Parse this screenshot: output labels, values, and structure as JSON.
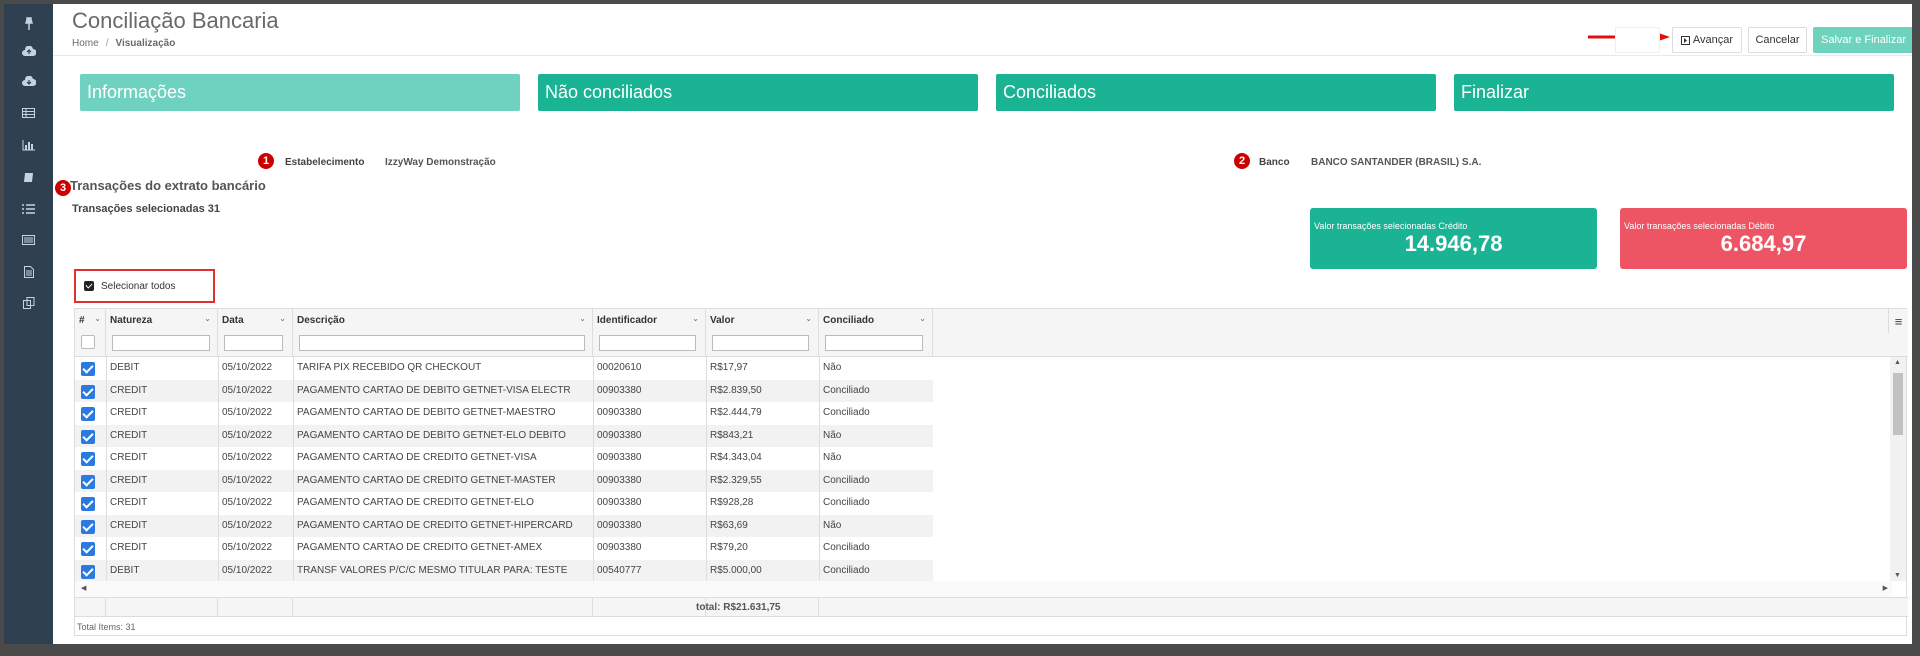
{
  "header": {
    "title": "Conciliação Bancaria",
    "breadcrumb": [
      {
        "label": "Home"
      },
      {
        "label": "Visualização"
      }
    ],
    "buttons": {
      "avancar": "Avançar",
      "cancelar": "Cancelar",
      "salvar": "Salvar e Finalizar"
    }
  },
  "steps": [
    "Informações",
    "Não conciliados",
    "Conciliados",
    "Finalizar"
  ],
  "info": {
    "estabelecimento_label": "Estabelecimento",
    "estabelecimento_value": "IzzyWay Demonstração",
    "banco_label": "Banco",
    "banco_value": "BANCO SANTANDER (BRASIL) S.A."
  },
  "badges": [
    "1",
    "2",
    "3"
  ],
  "section": {
    "title": "Transações do extrato bancário",
    "selected_text": "Transações selecionadas 31"
  },
  "kpis": {
    "credit_label": "Valor transações selecionadas Crédito",
    "credit_value": "14.946,78",
    "debit_label": "Valor transações selecionadas Débito",
    "debit_value": "6.684,97"
  },
  "select_all_label": "Selecionar todos",
  "grid": {
    "columns": [
      "#",
      "Natureza",
      "Data",
      "Descrição",
      "Identificador",
      "Valor",
      "Conciliado"
    ],
    "rows": [
      {
        "natureza": "DEBIT",
        "data": "05/10/2022",
        "descricao": "TARIFA PIX RECEBIDO QR CHECKOUT",
        "identificador": "00020610",
        "valor": "R$17,97",
        "conciliado": "Não"
      },
      {
        "natureza": "CREDIT",
        "data": "05/10/2022",
        "descricao": "PAGAMENTO CARTAO DE DEBITO GETNET-VISA ELECTR",
        "identificador": "00903380",
        "valor": "R$2.839,50",
        "conciliado": "Conciliado"
      },
      {
        "natureza": "CREDIT",
        "data": "05/10/2022",
        "descricao": "PAGAMENTO CARTAO DE DEBITO GETNET-MAESTRO",
        "identificador": "00903380",
        "valor": "R$2.444,79",
        "conciliado": "Conciliado"
      },
      {
        "natureza": "CREDIT",
        "data": "05/10/2022",
        "descricao": "PAGAMENTO CARTAO DE DEBITO GETNET-ELO DEBITO",
        "identificador": "00903380",
        "valor": "R$843,21",
        "conciliado": "Não"
      },
      {
        "natureza": "CREDIT",
        "data": "05/10/2022",
        "descricao": "PAGAMENTO CARTAO DE CREDITO GETNET-VISA",
        "identificador": "00903380",
        "valor": "R$4.343,04",
        "conciliado": "Não"
      },
      {
        "natureza": "CREDIT",
        "data": "05/10/2022",
        "descricao": "PAGAMENTO CARTAO DE CREDITO GETNET-MASTER",
        "identificador": "00903380",
        "valor": "R$2.329,55",
        "conciliado": "Conciliado"
      },
      {
        "natureza": "CREDIT",
        "data": "05/10/2022",
        "descricao": "PAGAMENTO CARTAO DE CREDITO GETNET-ELO",
        "identificador": "00903380",
        "valor": "R$928,28",
        "conciliado": "Conciliado"
      },
      {
        "natureza": "CREDIT",
        "data": "05/10/2022",
        "descricao": "PAGAMENTO CARTAO DE CREDITO GETNET-HIPERCARD",
        "identificador": "00903380",
        "valor": "R$63,69",
        "conciliado": "Não"
      },
      {
        "natureza": "CREDIT",
        "data": "05/10/2022",
        "descricao": "PAGAMENTO CARTAO DE CREDITO GETNET-AMEX",
        "identificador": "00903380",
        "valor": "R$79,20",
        "conciliado": "Conciliado"
      },
      {
        "natureza": "DEBIT",
        "data": "05/10/2022",
        "descricao": "TRANSF VALORES P/C/C MESMO TITULAR PARA: TESTE",
        "identificador": "00540777",
        "valor": "R$5.000,00",
        "conciliado": "Conciliado"
      }
    ],
    "footer_total": "total: R$21.631,75",
    "total_items": "Total Items: 31"
  },
  "colors": {
    "sidebar": "#2f4050",
    "step": "#1ab394",
    "step_active": "#6fd1bf",
    "credit": "#1ab394",
    "debit": "#ed5565",
    "badge": "#cc0000",
    "checkbox": "#2a7ae2"
  },
  "icons": [
    "pin-icon",
    "cloud-upload-icon",
    "cloud-download-icon",
    "table-icon",
    "bar-chart-icon",
    "book-icon",
    "list-icon",
    "list-alt-icon",
    "document-icon",
    "copy-icon",
    "red-arrow-icon",
    "grid-menu-icon"
  ]
}
